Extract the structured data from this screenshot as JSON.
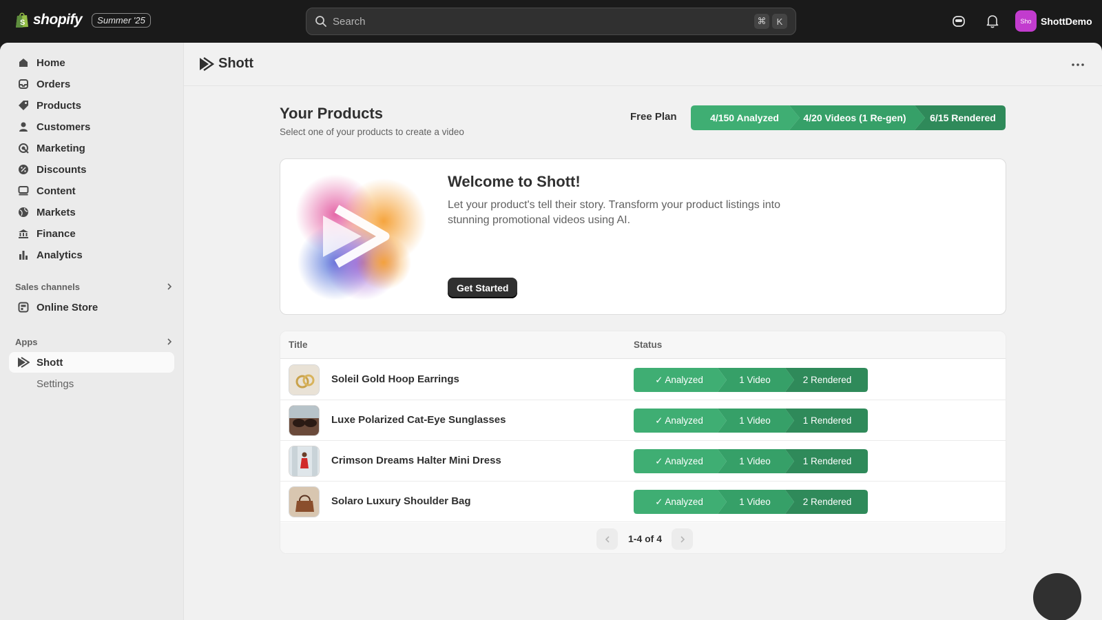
{
  "topbar": {
    "brand": "shopify",
    "edition": "Summer '25",
    "search_placeholder": "Search",
    "shortcut_keys": [
      "⌘",
      "K"
    ],
    "user_initials": "Sho",
    "user_name": "ShottDemo"
  },
  "sidebar": {
    "items": [
      {
        "label": "Home",
        "icon": "home-icon"
      },
      {
        "label": "Orders",
        "icon": "inbox-icon"
      },
      {
        "label": "Products",
        "icon": "tag-icon"
      },
      {
        "label": "Customers",
        "icon": "person-icon"
      },
      {
        "label": "Marketing",
        "icon": "target-icon"
      },
      {
        "label": "Discounts",
        "icon": "discount-icon"
      },
      {
        "label": "Content",
        "icon": "content-icon"
      },
      {
        "label": "Markets",
        "icon": "globe-icon"
      },
      {
        "label": "Finance",
        "icon": "bank-icon"
      },
      {
        "label": "Analytics",
        "icon": "bar-chart-icon"
      }
    ],
    "sales_channels_label": "Sales channels",
    "online_store_label": "Online Store",
    "apps_label": "Apps",
    "app_shott_label": "Shott",
    "app_settings_label": "Settings"
  },
  "page": {
    "app_title": "Shott",
    "heading": "Your Products",
    "subheading": "Select one of your products to create a video",
    "plan_label": "Free Plan",
    "plan_usage": [
      "4/150 Analyzed",
      "4/20 Videos (1 Re-gen)",
      "6/15 Rendered"
    ]
  },
  "welcome": {
    "title": "Welcome to Shott!",
    "text": "Let your product's tell their story. Transform your product listings into stunning promotional videos using AI.",
    "cta": "Get Started"
  },
  "table": {
    "columns": [
      "Title",
      "Status"
    ],
    "rows": [
      {
        "title": "Soleil Gold Hoop Earrings",
        "analyzed": "✓ Analyzed",
        "videos": "1 Video",
        "rendered": "2 Rendered"
      },
      {
        "title": "Luxe Polarized Cat-Eye Sunglasses",
        "analyzed": "✓ Analyzed",
        "videos": "1 Video",
        "rendered": "1 Rendered"
      },
      {
        "title": "Crimson Dreams Halter Mini Dress",
        "analyzed": "✓ Analyzed",
        "videos": "1 Video",
        "rendered": "1 Rendered"
      },
      {
        "title": "Solaro Luxury Shoulder Bag",
        "analyzed": "✓ Analyzed",
        "videos": "1 Video",
        "rendered": "2 Rendered"
      }
    ],
    "pagination": "1-4 of 4"
  },
  "colors": {
    "step1": "#3fae73",
    "step2": "#36a068",
    "step3": "#2f8a5a",
    "status_bar_bg": "#1a1a1a",
    "avatar": "#c23cce"
  }
}
